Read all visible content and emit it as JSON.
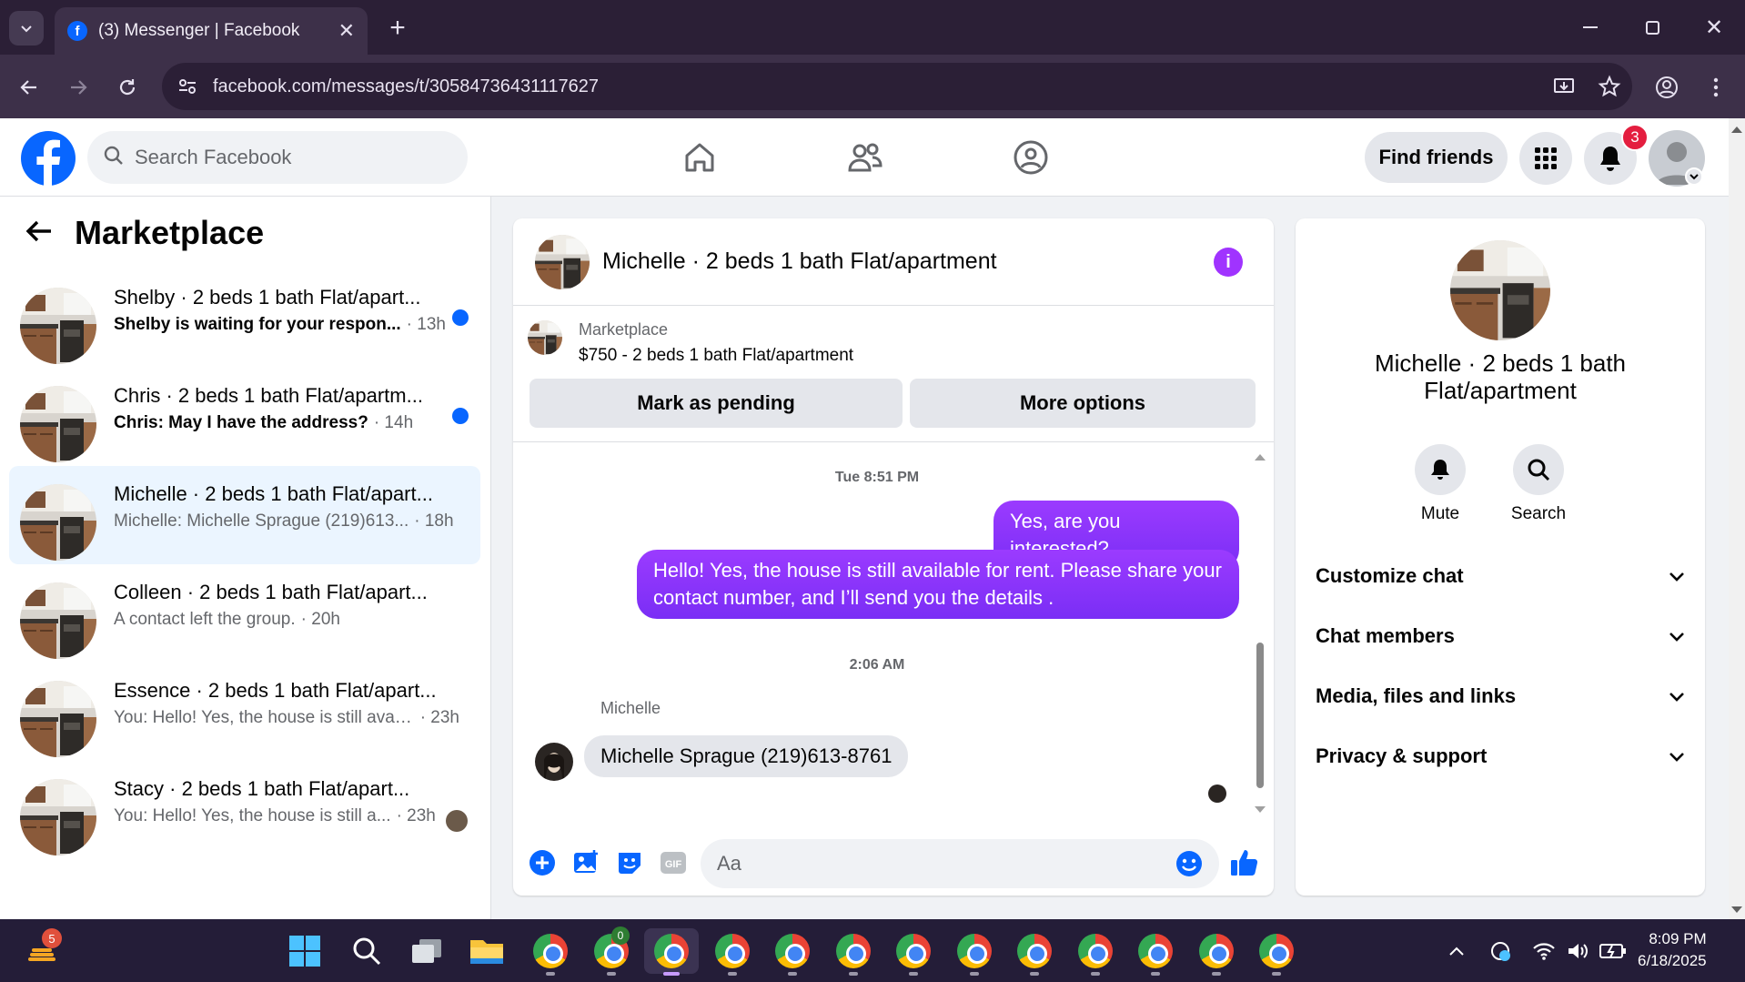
{
  "browser": {
    "tab_title": "(3) Messenger | Facebook",
    "url": "facebook.com/messages/t/30584736431117627"
  },
  "fb_header": {
    "search_placeholder": "Search Facebook",
    "find_friends_label": "Find friends",
    "notification_count": "3"
  },
  "left_pane": {
    "title": "Marketplace",
    "conversations": [
      {
        "name": "Shelby · 2 beds 1 bath Flat/apart...",
        "preview": "Shelby is waiting for your respon...",
        "time": "· 13h",
        "unread": true
      },
      {
        "name": "Chris · 2 beds 1 bath Flat/apartm...",
        "preview": "Chris: May I have the address?",
        "time": "· 14h",
        "unread": true
      },
      {
        "name": "Michelle · 2 beds 1 bath Flat/apart...",
        "preview": "Michelle: Michelle Sprague (219)613...",
        "time": "· 18h",
        "unread": false
      },
      {
        "name": "Colleen · 2 beds 1 bath Flat/apart...",
        "preview": "A contact left the group.",
        "time": "· 20h",
        "unread": false
      },
      {
        "name": "Essence · 2 beds 1 bath Flat/apart...",
        "preview": "You: Hello! Yes, the house is still avail...",
        "time": "· 23h",
        "unread": false
      },
      {
        "name": "Stacy · 2 beds 1 bath Flat/apart...",
        "preview": "You: Hello! Yes, the house is still a...",
        "time": "· 23h",
        "unread": false
      }
    ]
  },
  "chat": {
    "header_title": "Michelle · 2 beds 1 bath Flat/apartment",
    "marketplace_label": "Marketplace",
    "listing": "$750 - 2 beds 1 bath Flat/apartment",
    "mark_pending_label": "Mark as pending",
    "more_options_label": "More options",
    "timestamp1": "Tue 8:51 PM",
    "msg_out1": "Yes, are you interested?",
    "msg_out2": "Hello! Yes, the house is still available for rent. Please share your contact number, and I’ll send you the details .",
    "timestamp2": "2:06 AM",
    "sender_name": "Michelle",
    "msg_in1": "Michelle Sprague (219)613-8761",
    "composer_placeholder": "Aa"
  },
  "right_pane": {
    "name": "Michelle · 2 beds 1 bath Flat/apartment",
    "mute_label": "Mute",
    "search_label": "Search",
    "sections": [
      "Customize chat",
      "Chat members",
      "Media, files and links",
      "Privacy & support"
    ]
  },
  "taskbar": {
    "time": "8:09 PM",
    "date": "6/18/2025",
    "widget_badge": "5",
    "chrome_badge": "0"
  },
  "colors": {
    "fb_blue": "#0866ff",
    "messenger_purple": "#8a36f7",
    "unread_dot": "#0866ff",
    "notif_red": "#e41e3f"
  }
}
